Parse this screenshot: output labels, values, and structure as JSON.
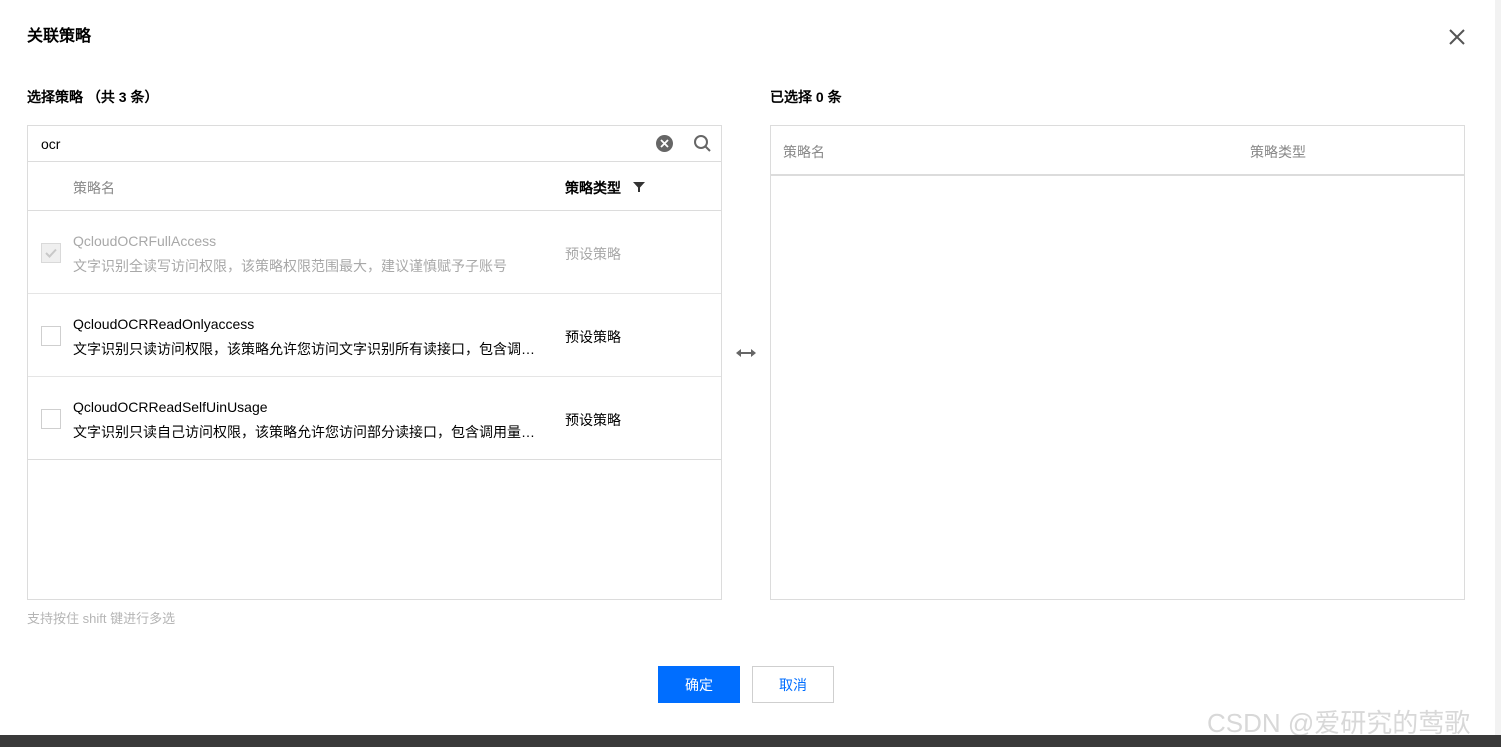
{
  "dialog": {
    "title": "关联策略"
  },
  "left": {
    "label": "选择策略 （共 3 条）",
    "search": {
      "value": "ocr"
    },
    "columns": {
      "name": "策略名",
      "type": "策略类型"
    },
    "rows": [
      {
        "name": "QcloudOCRFullAccess",
        "desc": "文字识别全读写访问权限，该策略权限范围最大，建议谨慎赋予子账号",
        "type": "预设策略",
        "checked": true,
        "disabled": true
      },
      {
        "name": "QcloudOCRReadOnlyaccess",
        "desc": "文字识别只读访问权限，该策略允许您访问文字识别所有读接口，包含调用接口",
        "type": "预设策略",
        "checked": false,
        "disabled": false
      },
      {
        "name": "QcloudOCRReadSelfUinUsage",
        "desc": "文字识别只读自己访问权限，该策略允许您访问部分读接口，包含调用量查询",
        "type": "预设策略",
        "checked": false,
        "disabled": false
      }
    ]
  },
  "right": {
    "label": "已选择 0 条",
    "columns": {
      "name": "策略名",
      "type": "策略类型"
    }
  },
  "hint": "支持按住 shift 键进行多选",
  "buttons": {
    "ok": "确定",
    "cancel": "取消"
  },
  "watermark": "CSDN @爱研究的莺歌",
  "colors": {
    "primary": "#006eff",
    "border": "#dcdcdc",
    "muted": "#888888"
  }
}
